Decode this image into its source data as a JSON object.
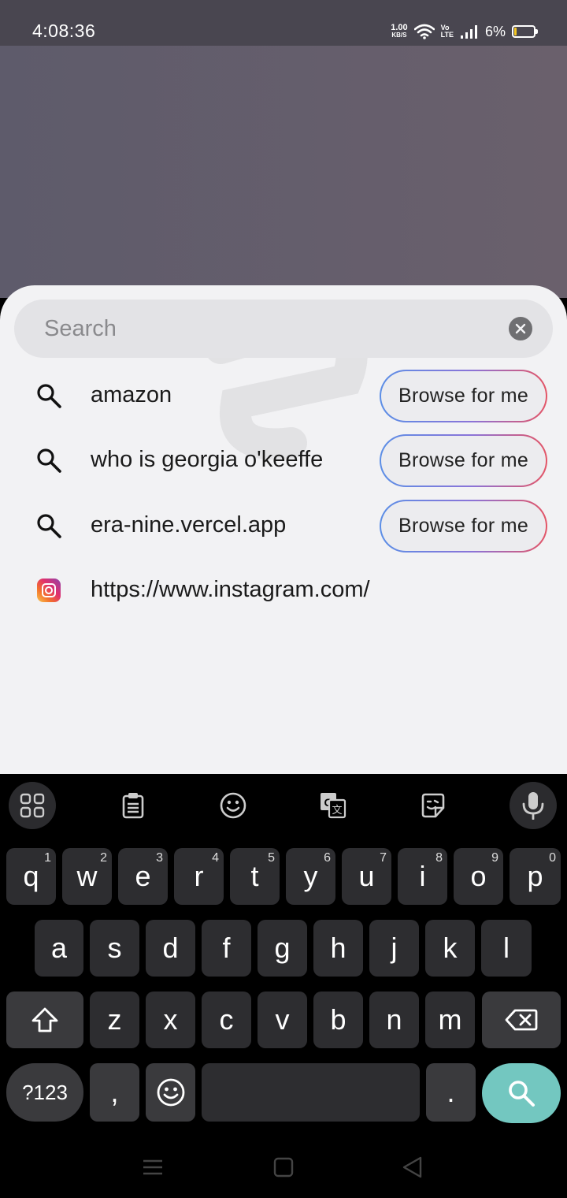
{
  "status_bar": {
    "time": "4:08:36",
    "net_speed_value": "1.00",
    "net_speed_unit": "KB/S",
    "volte_top": "Vo",
    "volte_bottom": "LTE",
    "battery_percent": "6%"
  },
  "search": {
    "placeholder": "Search",
    "value": ""
  },
  "suggestions": [
    {
      "icon": "search-icon",
      "text": "amazon",
      "button": "Browse for me"
    },
    {
      "icon": "search-icon",
      "text": "who is georgia o'keeffe",
      "button": "Browse for me"
    },
    {
      "icon": "search-icon",
      "text": "era-nine.vercel.app",
      "button": "Browse for me"
    },
    {
      "icon": "instagram-icon",
      "text": "https://www.instagram.com/"
    }
  ],
  "keyboard": {
    "row1": [
      {
        "key": "q",
        "hint": "1"
      },
      {
        "key": "w",
        "hint": "2"
      },
      {
        "key": "e",
        "hint": "3"
      },
      {
        "key": "r",
        "hint": "4"
      },
      {
        "key": "t",
        "hint": "5"
      },
      {
        "key": "y",
        "hint": "6"
      },
      {
        "key": "u",
        "hint": "7"
      },
      {
        "key": "i",
        "hint": "8"
      },
      {
        "key": "o",
        "hint": "9"
      },
      {
        "key": "p",
        "hint": "0"
      }
    ],
    "row2": [
      "a",
      "s",
      "d",
      "f",
      "g",
      "h",
      "j",
      "k",
      "l"
    ],
    "row3": [
      "z",
      "x",
      "c",
      "v",
      "b",
      "n",
      "m"
    ],
    "symbols_label": "?123",
    "comma": ",",
    "period": "."
  },
  "colors": {
    "browse_gradient_start": "#5c8fe6",
    "browse_gradient_end": "#e45566",
    "search_key": "#73c7c0"
  }
}
